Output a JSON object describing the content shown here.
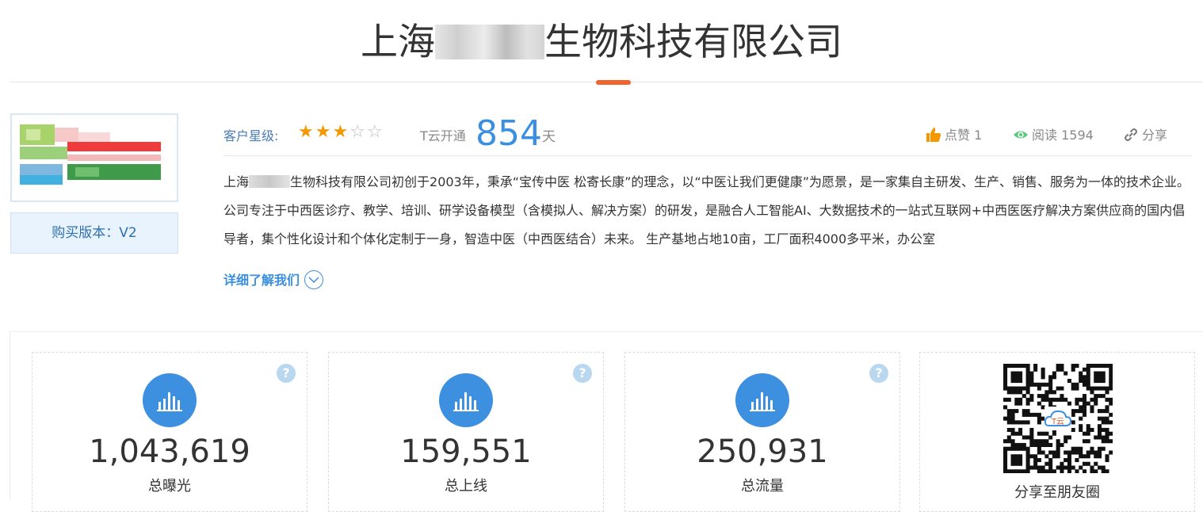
{
  "header": {
    "title_prefix": "上海",
    "title_suffix": "生物科技有限公司"
  },
  "sidebar": {
    "version_label": "购买版本：V2"
  },
  "meta": {
    "rating_label": "客户星级:",
    "rating_value": 3,
    "rating_max": 5,
    "tcloud_label": "T云开通",
    "tcloud_days": "854",
    "tcloud_unit": "天",
    "like_label": "点赞",
    "like_count": "1",
    "read_label": "阅读",
    "read_count": "1594",
    "share_label": "分享"
  },
  "description": {
    "part1": "上海",
    "part2": "生物科技有限公司初创于2003年，秉承“宝传中医 松寄长康”的理念，以“中医让我们更健康”为愿景，是一家集自主研发、生产、销售、服务为一体的技术企业。公司专注于中西医诊疗、教学、培训、研学设备模型（含模拟人、解决方案）的研发，是融合人工智能AI、大数据技术的一站式互联网+中西医医疗解决方案供应商的国内倡导者，集个性化设计和个体化定制于一身，智造中医（中西医结合）未来。 生产基地占地10亩，工厂面积4000多平米，办公室",
    "more_label": "详细了解我们"
  },
  "stats": [
    {
      "value": "1,043,619",
      "label": "总曝光"
    },
    {
      "value": "159,551",
      "label": "总上线"
    },
    {
      "value": "250,931",
      "label": "总流量"
    }
  ],
  "share": {
    "qr_label": "分享至朋友圈",
    "qr_logo_text": "T云"
  },
  "colors": {
    "accent": "#f0642d",
    "primary_blue": "#3b8fe0",
    "star": "#f39800"
  }
}
